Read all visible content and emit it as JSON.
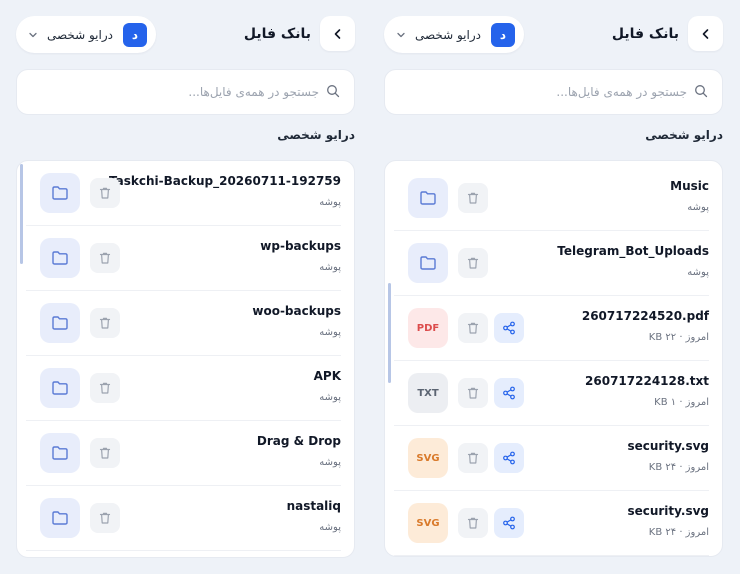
{
  "left_panel": {
    "title": "بانک فایل",
    "drive_select": {
      "label": "درایو شخصی",
      "avatar": "د"
    },
    "search": {
      "placeholder": "جستجو در همه‌ی فایل‌ها..."
    },
    "section_title": "درایو شخصی",
    "items": [
      {
        "name": "Taskchi-Backup_20260711-192759",
        "meta": "پوشه",
        "icon": "folder-icon"
      },
      {
        "name": "wp-backups",
        "meta": "پوشه",
        "icon": "folder-icon"
      },
      {
        "name": "woo-backups",
        "meta": "پوشه",
        "icon": "folder-icon"
      },
      {
        "name": "APK",
        "meta": "پوشه",
        "icon": "folder-icon"
      },
      {
        "name": "Drag & Drop",
        "meta": "پوشه",
        "icon": "folder-icon"
      },
      {
        "name": "nastaliq",
        "meta": "پوشه",
        "icon": "folder-icon"
      }
    ]
  },
  "right_panel": {
    "title": "بانک فایل",
    "drive_select": {
      "label": "درایو شخصی",
      "avatar": "د"
    },
    "search": {
      "placeholder": "جستجو در همه‌ی فایل‌ها..."
    },
    "section_title": "درایو شخصی",
    "items": [
      {
        "name": "Music",
        "meta": "پوشه",
        "icon": "folder-icon"
      },
      {
        "name": "Telegram_Bot_Uploads",
        "meta": "پوشه",
        "icon": "folder-icon"
      },
      {
        "name": "260717224520.pdf",
        "meta": "امروز · ۲۲ KB",
        "badge": "PDF"
      },
      {
        "name": "260717224128.txt",
        "meta": "امروز · ۱ KB",
        "badge": "TXT"
      },
      {
        "name": "security.svg",
        "meta": "امروز · ۲۴ KB",
        "badge": "SVG"
      },
      {
        "name": "security.svg",
        "meta": "امروز · ۲۴ KB",
        "badge": "SVG"
      }
    ]
  },
  "colors": {
    "accent": "#2563eb",
    "folder_bg": "#e8edfb",
    "pdf": "#dc4c4c",
    "txt": "#5b6472",
    "svg": "#d97a2b",
    "background": "#eef2f8"
  }
}
